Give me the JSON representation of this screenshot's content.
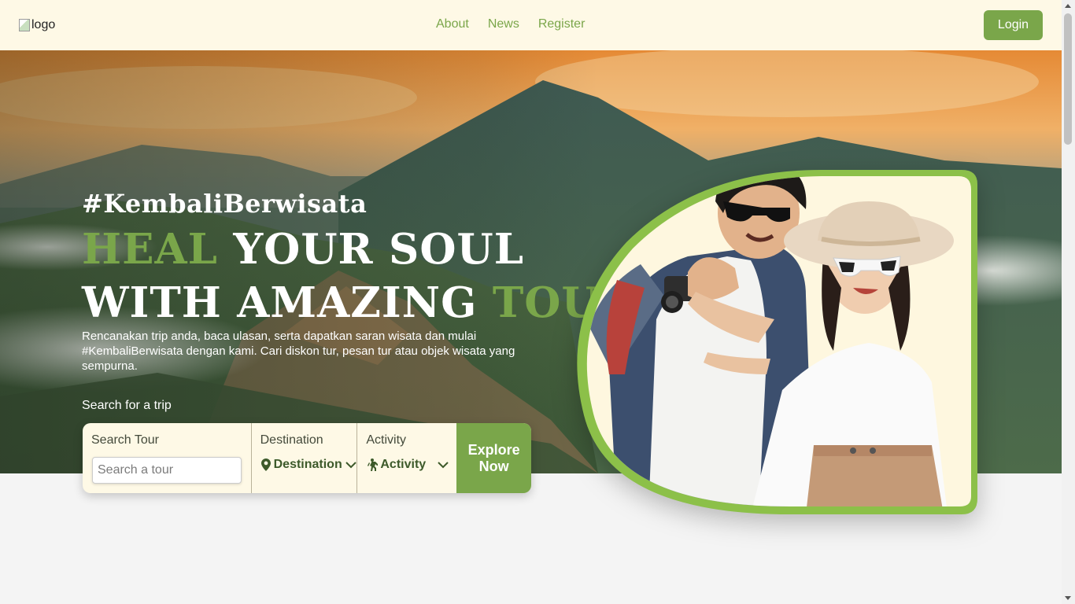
{
  "navbar": {
    "logo_alt": "logo",
    "links": [
      "About",
      "News",
      "Register"
    ],
    "login_label": "Login",
    "accent_color": "#7aa64a",
    "background_color": "#fef9e6"
  },
  "hero": {
    "tagline": "#KembaliBerwisata",
    "headline": {
      "line1_highlight": "HEAL",
      "line1_rest": "YOUR SOUL",
      "line2_rest": "WITH AMAZING",
      "line2_highlight": "TOUR"
    },
    "description": "Rencanakan trip anda, baca ulasan, serta dapatkan saran wisata dan mulai #KembaliBerwisata dengan kami. Cari diskon tur, pesan tur atau objek wisata yang sempurna.",
    "search_label": "Search for a trip"
  },
  "search": {
    "tour_title": "Search Tour",
    "tour_placeholder": "Search a tour",
    "destination_title": "Destination",
    "destination_value": "Destination",
    "activity_title": "Activity",
    "activity_value": "Activity",
    "explore_line1": "Explore",
    "explore_line2": "Now"
  },
  "icons": {
    "destination": "map-pin-icon",
    "activity": "hiking-icon",
    "dropdown": "chevron-down-icon"
  }
}
